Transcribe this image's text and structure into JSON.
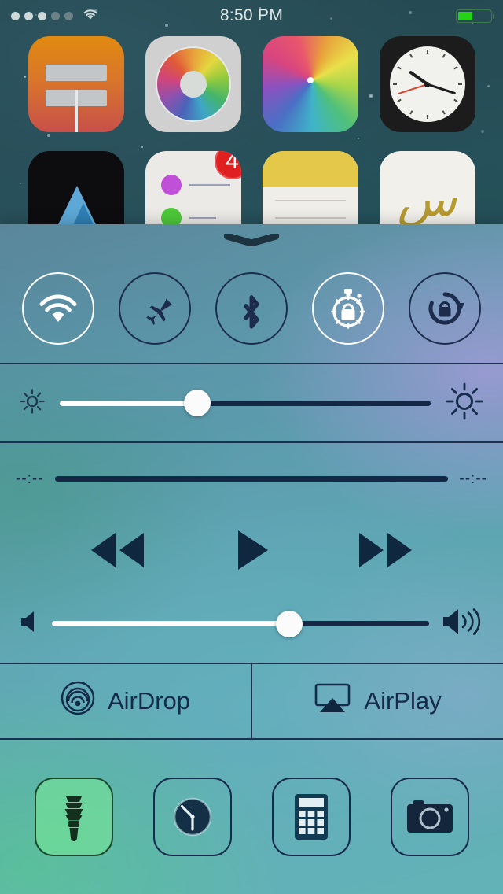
{
  "status_bar": {
    "signal_dots_filled": 3,
    "signal_dots_total": 5,
    "wifi_icon": "wifi-icon",
    "time": "8:50 PM",
    "battery_icon": "battery-icon",
    "battery_percent": 45
  },
  "home_screen": {
    "row1": [
      {
        "name": "sign-app-icon",
        "label": ""
      },
      {
        "name": "color-wheel-app-icon",
        "label": ""
      },
      {
        "name": "photos-app-icon",
        "label": ""
      },
      {
        "name": "clock-app-icon",
        "label": ""
      }
    ],
    "row2": [
      {
        "name": "mountain-app-icon",
        "label": ""
      },
      {
        "name": "reminders-app-icon",
        "label": "",
        "badge": "4"
      },
      {
        "name": "notes-app-icon",
        "label": ""
      },
      {
        "name": "gold-script-app-icon",
        "label": "س"
      }
    ]
  },
  "control_center": {
    "grabber_icon": "chevron-down-grabber-icon",
    "toggles": [
      {
        "name": "wifi-toggle",
        "icon": "wifi-icon",
        "state": "on"
      },
      {
        "name": "airplane-toggle",
        "icon": "airplane-icon",
        "state": "off"
      },
      {
        "name": "bluetooth-toggle",
        "icon": "bluetooth-icon",
        "state": "off"
      },
      {
        "name": "do-not-disturb-toggle",
        "icon": "stopwatch-lock-icon",
        "state": "on"
      },
      {
        "name": "rotation-lock-toggle",
        "icon": "rotation-lock-icon",
        "state": "off"
      }
    ],
    "brightness": {
      "low_icon": "sun-small-icon",
      "high_icon": "sun-large-icon",
      "value_percent": 37
    },
    "media": {
      "elapsed_time": "--:--",
      "remaining_time": "--:--",
      "progress_percent": 0,
      "controls": [
        {
          "name": "rewind-button",
          "icon": "rewind-icon"
        },
        {
          "name": "play-button",
          "icon": "play-icon"
        },
        {
          "name": "fast-forward-button",
          "icon": "fast-forward-icon"
        }
      ],
      "volume": {
        "mute_icon": "speaker-mute-icon",
        "max_icon": "speaker-waves-icon",
        "value_percent": 63
      }
    },
    "sharing": [
      {
        "name": "airdrop-button",
        "label": "AirDrop",
        "icon": "airdrop-icon"
      },
      {
        "name": "airplay-button",
        "label": "AirPlay",
        "icon": "airplay-icon"
      }
    ],
    "shortcuts": [
      {
        "name": "flashlight-button",
        "icon": "flashlight-icon",
        "state": "on"
      },
      {
        "name": "timer-button",
        "icon": "timer-icon",
        "state": "off"
      },
      {
        "name": "calculator-button",
        "icon": "calculator-icon",
        "state": "off"
      },
      {
        "name": "camera-button",
        "icon": "camera-icon",
        "state": "off"
      }
    ]
  },
  "colors": {
    "accent_on": "#ffffff",
    "accent_off": "#1d2c4d",
    "divider": "#142845",
    "battery_green": "#24d318",
    "badge_red": "#e02020",
    "flashlight_green": "#78eb96"
  }
}
